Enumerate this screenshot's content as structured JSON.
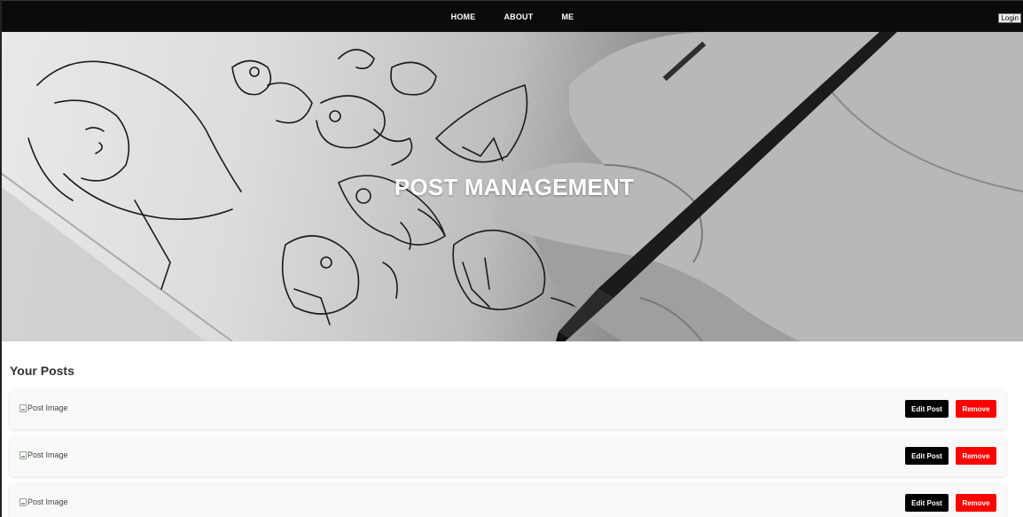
{
  "nav": {
    "links": [
      "HOME",
      "ABOUT",
      "ME"
    ],
    "login_label": "Login"
  },
  "hero": {
    "title": "POST MANAGEMENT"
  },
  "posts_section": {
    "title": "Your Posts",
    "posts": [
      {
        "image_alt": "Post Image",
        "edit_label": "Edit Post",
        "remove_label": "Remove"
      },
      {
        "image_alt": "Post Image",
        "edit_label": "Edit Post",
        "remove_label": "Remove"
      },
      {
        "image_alt": "Post Image",
        "edit_label": "Edit Post",
        "remove_label": "Remove"
      }
    ]
  },
  "colors": {
    "navbar_bg": "#0b0b0b",
    "edit_button": "#000000",
    "remove_button": "#ff0000",
    "card_bg": "#f9f9f9"
  }
}
